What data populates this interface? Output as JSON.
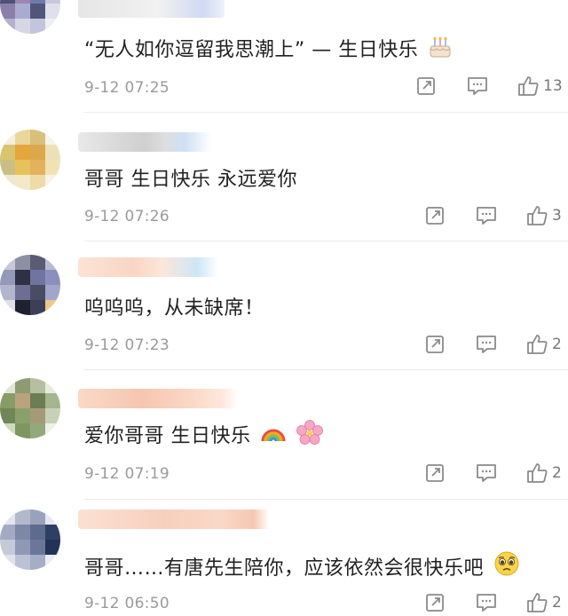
{
  "comments": [
    {
      "text": "“无人如你逗留我思潮上” — 生日快乐",
      "emoji": "birthday-cake",
      "time": "9-12 07:25",
      "likes": "13"
    },
    {
      "text": "哥哥 生日快乐 永远爱你",
      "emoji": "",
      "time": "9-12 07:26",
      "likes": "3"
    },
    {
      "text": "呜呜呜，从未缺席！",
      "emoji": "",
      "time": "9-12 07:23",
      "likes": "2"
    },
    {
      "text": "爱你哥哥 生日快乐",
      "emoji": "rainbow+flower",
      "time": "9-12 07:19",
      "likes": "2"
    },
    {
      "text": "哥哥……有唐先生陪你，应该依然会很快乐吧",
      "emoji": "pleading-face",
      "time": "9-12 06:50",
      "likes": "2"
    }
  ],
  "colors": {
    "meta": "#9a9a9a",
    "icon": "#8a8a8a",
    "text": "#222222"
  }
}
